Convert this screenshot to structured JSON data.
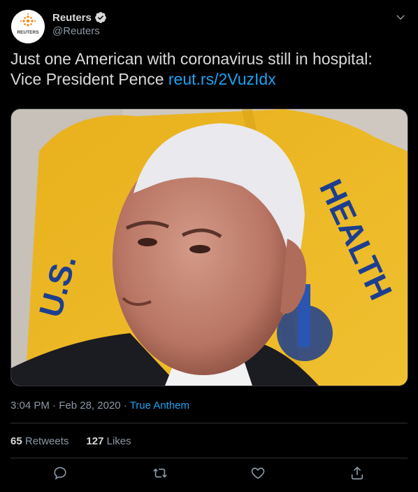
{
  "account": {
    "name": "Reuters",
    "handle": "@Reuters",
    "logo_text": "REUTERS"
  },
  "tweet": {
    "text": "Just one American with coronavirus still in hospital: Vice President Pence ",
    "link": "reut.rs/2VuzIdx",
    "time": "3:04 PM",
    "separator": " · ",
    "date": "Feb 28, 2020",
    "source": "True Anthem"
  },
  "stats": {
    "retweets_count": "65",
    "retweets_label": "Retweets",
    "likes_count": "127",
    "likes_label": "Likes"
  },
  "icons": {
    "reply": "reply-icon",
    "retweet": "retweet-icon",
    "like": "heart-icon",
    "share": "share-icon"
  },
  "colors": {
    "background": "#000000",
    "link": "#1da1f2",
    "muted": "#8b98a5",
    "reuters_orange": "#ff8000"
  }
}
